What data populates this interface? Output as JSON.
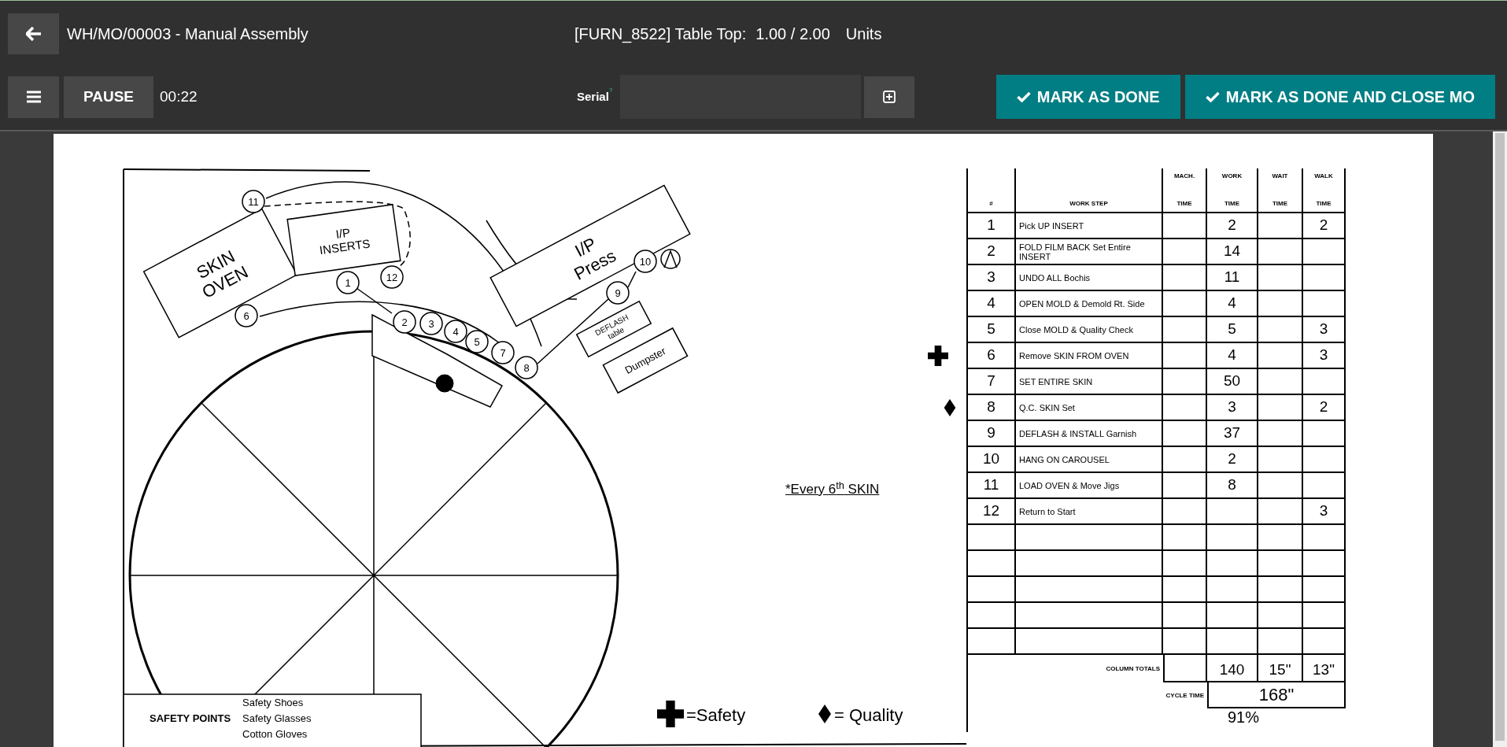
{
  "header": {
    "title": "WH/MO/00003 - Manual Assembly",
    "product": "[FURN_8522] Table Top:",
    "quantity": "1.00 / 2.00",
    "uom": "Units"
  },
  "toolbar": {
    "pause": "PAUSE",
    "timer": "00:22",
    "serial_label": "Serial",
    "serial_hint": "?",
    "buttons": [
      "MARK AS DONE",
      "MARK AS DONE AND CLOSE MO"
    ]
  },
  "worksheet": {
    "stations": [
      {
        "lines": [
          "SKIN",
          "OVEN"
        ]
      },
      {
        "lines": [
          "I/P",
          "INSERTS"
        ]
      },
      {
        "lines": [
          "I/P",
          "Press"
        ]
      },
      {
        "lines": [
          "DEFLASH",
          "table"
        ]
      },
      {
        "lines": [
          "Dumpster"
        ]
      }
    ],
    "step_markers": [
      "11",
      "12",
      "1",
      "6",
      "2",
      "3",
      "4",
      "5",
      "7",
      "8",
      "9",
      "10"
    ],
    "note": "*Every 6$^{th}$ SKIN",
    "columns": [
      {
        "bottom": "#"
      },
      {
        "bottom": "WORK STEP"
      },
      {
        "top": "MACH.",
        "bottom": "TIME"
      },
      {
        "top": "WORK",
        "bottom": "TIME"
      },
      {
        "top": "WAIT",
        "bottom": "TIME"
      },
      {
        "top": "WALK",
        "bottom": "TIME"
      }
    ],
    "rows": [
      {
        "num": "1",
        "step": "Pick UP INSERT",
        "work": "2",
        "walk": "2",
        "safety_mark": false,
        "quality_mark": false,
        "note": false
      },
      {
        "num": "2",
        "step": "FOLD FILM BACK Set Entire INSERT",
        "work": "14",
        "safety_mark": false,
        "quality_mark": false,
        "note": false
      },
      {
        "num": "3",
        "step": "UNDO ALL Bochis",
        "work": "11",
        "safety_mark": false,
        "quality_mark": false,
        "note": false
      },
      {
        "num": "4",
        "step": "OPEN MOLD & Demold Rt. Side",
        "work": "4",
        "safety_mark": false,
        "quality_mark": false,
        "note": false
      },
      {
        "num": "5",
        "step": "Close MOLD & Quality Check",
        "work": "5",
        "walk": "3",
        "safety_mark": false,
        "quality_mark": false,
        "note": false
      },
      {
        "num": "6",
        "step": "Remove SKIN FROM OVEN",
        "work": "4",
        "walk": "3",
        "safety_mark": true,
        "quality_mark": false,
        "note": false
      },
      {
        "num": "7",
        "step": "SET ENTIRE SKIN",
        "work": "50",
        "safety_mark": false,
        "quality_mark": false,
        "note": false
      },
      {
        "num": "8",
        "step": "Q.C. SKIN Set",
        "work": "3",
        "walk": "2",
        "safety_mark": false,
        "quality_mark": true,
        "note": false
      },
      {
        "num": "9",
        "step": "DEFLASH & INSTALL Garnish",
        "work": "37",
        "safety_mark": false,
        "quality_mark": false,
        "note": false
      },
      {
        "num": "10",
        "step": "HANG ON CAROUSEL",
        "work": "2",
        "safety_mark": false,
        "quality_mark": false,
        "note": false
      },
      {
        "num": "11",
        "step": "LOAD OVEN & Move Jigs",
        "work": "8",
        "safety_mark": false,
        "quality_mark": false,
        "note": true
      },
      {
        "num": "12",
        "step": "Return to Start",
        "walk": "3",
        "safety_mark": false,
        "quality_mark": false,
        "note": false
      }
    ],
    "totals": {
      "label": "COLUMN TOTALS",
      "work": "140",
      "wait": "15\"",
      "walk": "13\""
    },
    "cycle_time": {
      "label": "CYCLE TIME",
      "value": "168\""
    },
    "efficiency": "91%",
    "safety_points": {
      "label": "SAFETY POINTS",
      "items": [
        "Safety Shoes",
        "Safety Glasses",
        "Cotton Gloves"
      ]
    },
    "legend": [
      {
        "kind": "safety",
        "label": "=Safety"
      },
      {
        "kind": "quality",
        "label": "= Quality"
      }
    ]
  }
}
